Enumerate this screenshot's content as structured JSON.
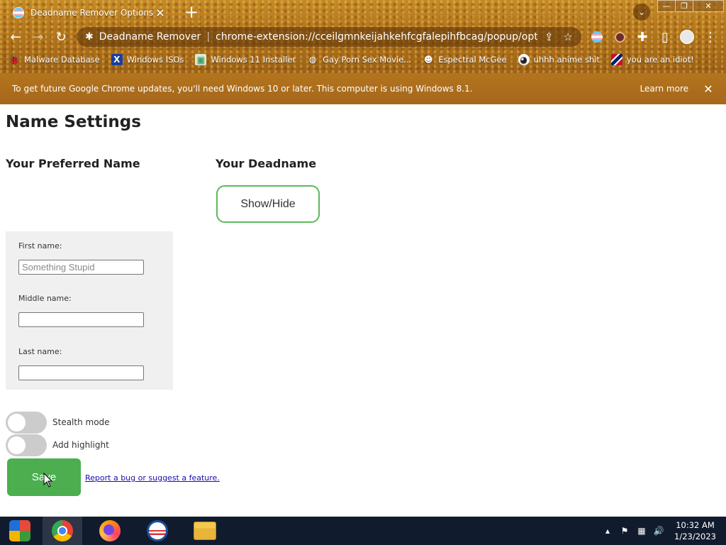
{
  "browser": {
    "tab_title": "Deadname Remover Options",
    "site_name": "Deadname Remover",
    "url": "chrome-extension://cceilgmnkeijahkehfcgfalepihfbcag/popup/option...",
    "bookmarks": [
      {
        "label": "Malware Database",
        "icon": "bug-icon"
      },
      {
        "label": "Windows ISOs",
        "icon": "x-icon"
      },
      {
        "label": "Windows 11 Installer",
        "icon": "image-icon"
      },
      {
        "label": "Gay Porn Sex Movie...",
        "icon": "globe-icon"
      },
      {
        "label": "Espectral McGee",
        "icon": "face-icon"
      },
      {
        "label": "uhhh anime shit",
        "icon": "anime-icon"
      },
      {
        "label": "you are an idiot!",
        "icon": "flag-icon"
      }
    ]
  },
  "infobar": {
    "message": "To get future Google Chrome updates, you'll need Windows 10 or later. This computer is using Windows 8.1.",
    "learn_more": "Learn more"
  },
  "page": {
    "title": "Name Settings",
    "preferred_heading": "Your Preferred Name",
    "deadname_heading": "Your Deadname",
    "show_hide_label": "Show/Hide",
    "first_name_label": "First name:",
    "first_name_placeholder": "Something Stupid",
    "first_name_value": "",
    "middle_name_label": "Middle name:",
    "middle_name_value": "",
    "last_name_label": "Last name:",
    "last_name_value": "",
    "stealth_label": "Stealth mode",
    "stealth_on": false,
    "highlight_label": "Add highlight",
    "highlight_on": false,
    "save_label": "Save",
    "bug_link": "Report a bug or suggest a feature."
  },
  "taskbar": {
    "time": "10:32 AM",
    "date": "1/23/2023",
    "apps": [
      "start",
      "chrome",
      "firefox",
      "obama",
      "file-explorer"
    ]
  },
  "colors": {
    "accent_green": "#4cae4f",
    "show_hide_border": "#5cb85c",
    "theme_brown": "#b6791f"
  }
}
